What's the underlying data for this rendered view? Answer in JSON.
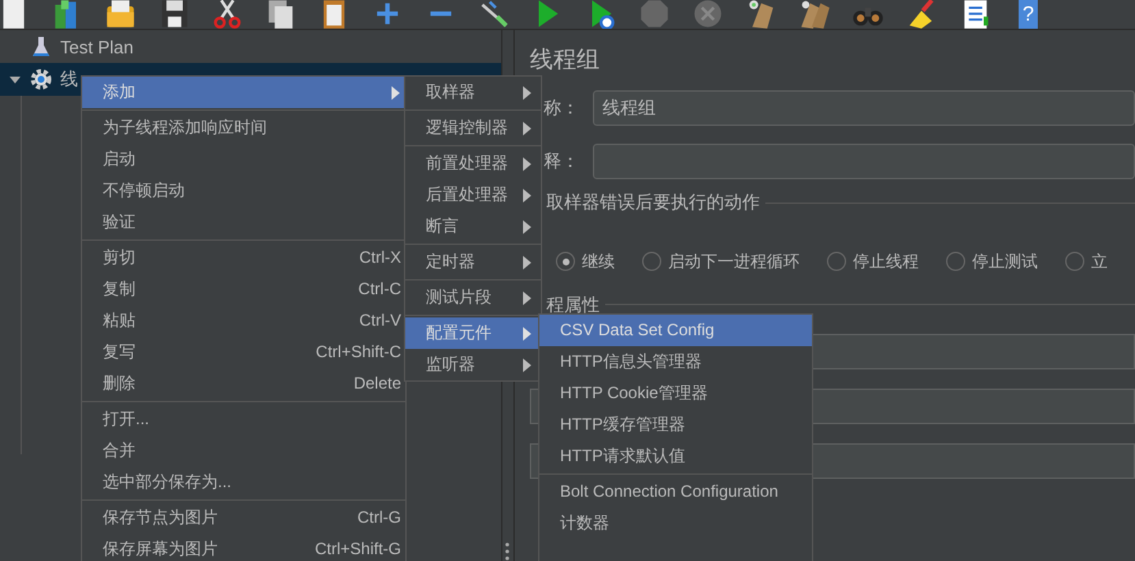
{
  "toolbar": {
    "help_glyph": "?"
  },
  "tree": [
    {
      "label": "Test Plan",
      "kind": "plan",
      "selected": false
    },
    {
      "label": "线",
      "kind": "thread-group",
      "selected": true,
      "expanded": true
    }
  ],
  "panel": {
    "title": "线程组",
    "fields": [
      {
        "label": "称：",
        "value": "线程组"
      },
      {
        "label": "释："
      }
    ],
    "error_action": {
      "title": "取样器错误后要执行的动作",
      "options": [
        {
          "label": "继续",
          "selected": true
        },
        {
          "label": "启动下一进程循环",
          "selected": false
        },
        {
          "label": "停止线程",
          "selected": false
        },
        {
          "label": "停止测试",
          "selected": false
        },
        {
          "label": "立",
          "selected": false
        }
      ]
    },
    "thread_properties": {
      "title": "程属性"
    }
  },
  "context_menu": {
    "items": [
      {
        "kind": "item",
        "label": "添加",
        "submenu": true,
        "selected": true
      },
      {
        "kind": "separator"
      },
      {
        "kind": "item",
        "label": "为子线程添加响应时间",
        "selected": false
      },
      {
        "kind": "item",
        "label": "启动",
        "selected": false
      },
      {
        "kind": "item",
        "label": "不停顿启动",
        "selected": false
      },
      {
        "kind": "item",
        "label": "验证",
        "selected": false
      },
      {
        "kind": "separator"
      },
      {
        "kind": "item",
        "label": "剪切",
        "shortcut": "Ctrl-X",
        "selected": false
      },
      {
        "kind": "item",
        "label": "复制",
        "shortcut": "Ctrl-C",
        "selected": false
      },
      {
        "kind": "item",
        "label": "粘贴",
        "shortcut": "Ctrl-V",
        "selected": false
      },
      {
        "kind": "item",
        "label": "复写",
        "shortcut": "Ctrl+Shift-C",
        "selected": false
      },
      {
        "kind": "item",
        "label": "删除",
        "shortcut": "Delete",
        "selected": false
      },
      {
        "kind": "separator"
      },
      {
        "kind": "item",
        "label": "打开...",
        "selected": false
      },
      {
        "kind": "item",
        "label": "合并",
        "selected": false
      },
      {
        "kind": "item",
        "label": "选中部分保存为...",
        "selected": false
      },
      {
        "kind": "separator"
      },
      {
        "kind": "item",
        "label": "保存节点为图片",
        "shortcut": "Ctrl-G",
        "selected": false
      },
      {
        "kind": "item",
        "label": "保存屏幕为图片",
        "shortcut": "Ctrl+Shift-G",
        "selected": false
      }
    ]
  },
  "add_submenu": {
    "items": [
      {
        "kind": "item",
        "label": "取样器",
        "submenu": true,
        "selected": false
      },
      {
        "kind": "separator"
      },
      {
        "kind": "item",
        "label": "逻辑控制器",
        "submenu": true,
        "selected": false
      },
      {
        "kind": "separator"
      },
      {
        "kind": "item",
        "label": "前置处理器",
        "submenu": true,
        "selected": false
      },
      {
        "kind": "item",
        "label": "后置处理器",
        "submenu": true,
        "selected": false
      },
      {
        "kind": "item",
        "label": "断言",
        "submenu": true,
        "selected": false
      },
      {
        "kind": "separator"
      },
      {
        "kind": "item",
        "label": "定时器",
        "submenu": true,
        "selected": false
      },
      {
        "kind": "separator"
      },
      {
        "kind": "item",
        "label": "测试片段",
        "submenu": true,
        "selected": false
      },
      {
        "kind": "separator"
      },
      {
        "kind": "item",
        "label": "配置元件",
        "submenu": true,
        "selected": true
      },
      {
        "kind": "item",
        "label": "监听器",
        "submenu": true,
        "selected": false
      }
    ]
  },
  "config_submenu": {
    "items": [
      {
        "kind": "item",
        "label": "CSV Data Set Config",
        "selected": true
      },
      {
        "kind": "item",
        "label": "HTTP信息头管理器",
        "selected": false
      },
      {
        "kind": "item",
        "label": "HTTP Cookie管理器",
        "selected": false
      },
      {
        "kind": "item",
        "label": "HTTP缓存管理器",
        "selected": false
      },
      {
        "kind": "item",
        "label": "HTTP请求默认值",
        "selected": false
      },
      {
        "kind": "separator"
      },
      {
        "kind": "item",
        "label": "Bolt Connection Configuration",
        "selected": false
      },
      {
        "kind": "item",
        "label": "计数器",
        "selected": false
      }
    ]
  }
}
